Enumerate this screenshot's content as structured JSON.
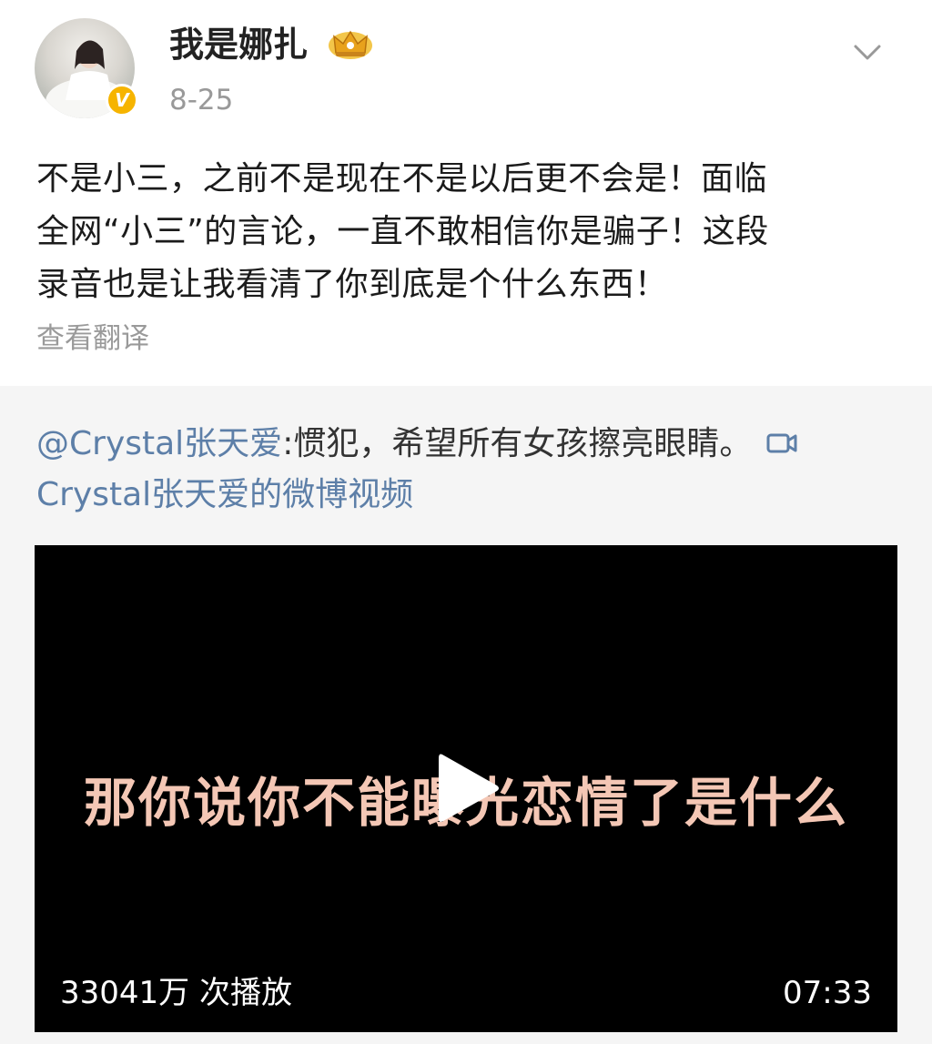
{
  "post": {
    "username": "我是娜扎",
    "date": "8-25",
    "text_lines": [
      "不是小三，之前不是现在不是以后更不会是！面临",
      "全网“小三”的言论，一直不敢相信你是骗子！这段",
      "录音也是让我看清了你到底是个什么东西！"
    ],
    "translate_label": "查看翻译",
    "verified_badge": "V"
  },
  "repost": {
    "mention": "@Crystal张天爱",
    "text": ":惯犯，希望所有女孩擦亮眼睛。",
    "video_link": "Crystal张天爱的微博视频"
  },
  "video": {
    "subtitle": "那你说你不能曝光恋情了是什么",
    "play_count": "33041万 次播放",
    "duration": "07:33"
  },
  "colors": {
    "link": "#5d7fa8",
    "verified": "#f6b400",
    "secondary_text": "#999999",
    "repost_background": "#f5f5f5"
  },
  "icons": [
    "crown-icon",
    "chevron-down-icon",
    "video-camera-icon",
    "play-icon",
    "verified-badge"
  ]
}
